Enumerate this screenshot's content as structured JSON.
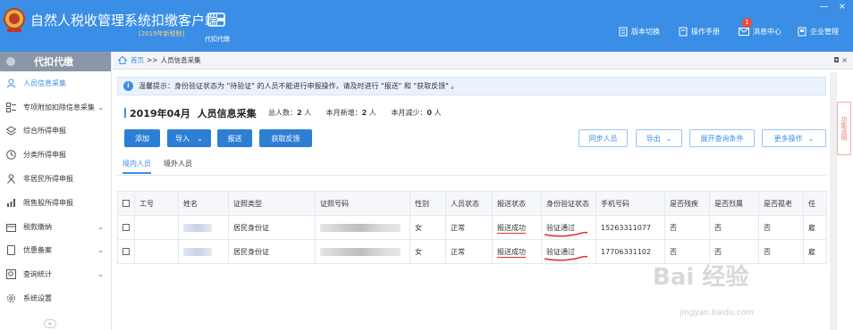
{
  "app": {
    "title": "自然人税收管理系统扣缴客户端",
    "edition": "[2019年新税制]",
    "mode_label": "代扣代缴",
    "colors": {
      "primary": "#3a8ee6",
      "alert": "#e0312b"
    }
  },
  "window_controls": {
    "minimize": "—",
    "close": "×"
  },
  "top_nav": [
    {
      "label": "版本切换",
      "icon": "switch-icon"
    },
    {
      "label": "操作手册",
      "icon": "manual-icon"
    },
    {
      "label": "消息中心",
      "icon": "message-icon",
      "badge": "1"
    },
    {
      "label": "企业管理",
      "icon": "company-icon"
    }
  ],
  "sidebar": {
    "title": "代扣代缴",
    "items": [
      {
        "label": "人员信息采集",
        "icon": "user-icon",
        "active": true
      },
      {
        "label": "专项附加扣除信息采集",
        "icon": "list-icon",
        "has_arrow": true
      },
      {
        "label": "综合所得申报",
        "icon": "layers-icon"
      },
      {
        "label": "分类所得申报",
        "icon": "clock-icon"
      },
      {
        "label": "非居民所得申报",
        "icon": "person-icon"
      },
      {
        "label": "限售股所得申报",
        "icon": "bar-chart-icon"
      },
      {
        "label": "税款缴纳",
        "icon": "box-icon",
        "has_arrow": true
      },
      {
        "label": "优惠备案",
        "icon": "document-icon",
        "has_arrow": true
      },
      {
        "label": "查询统计",
        "icon": "search-icon",
        "has_arrow": true
      },
      {
        "label": "系统设置",
        "icon": "gear-icon"
      }
    ],
    "collapse": "«"
  },
  "breadcrumb": {
    "home": "首页",
    "sep": ">>",
    "current": "人员信息采集",
    "controls": "◘ ×"
  },
  "notice": "温馨提示：身份验证状态为 \"待验证\" 的人员不能进行申报操作，请及时进行 \"报送\" 和 \"获取反馈\" 。",
  "side_tab": "功能说明",
  "section": {
    "period": "2019年04月",
    "title": "人员信息采集",
    "stats": [
      {
        "label": "总人数：",
        "value": "2",
        "unit": "人"
      },
      {
        "label": "本月新增：",
        "value": "2",
        "unit": "人"
      },
      {
        "label": "本月减少：",
        "value": "0",
        "unit": "人"
      }
    ]
  },
  "toolbar": {
    "add": "添加",
    "import": "导入",
    "submit": "报送",
    "feedback": "获取反馈",
    "sync": "同步人员",
    "export": "导出",
    "expand_query": "展开查询条件",
    "more": "更多操作"
  },
  "tabs": [
    "境内人员",
    "境外人员"
  ],
  "table": {
    "columns": [
      "",
      "工号",
      "姓名",
      "证照类型",
      "证照号码",
      "性别",
      "人员状态",
      "报送状态",
      "身份验证状态",
      "手机号码",
      "是否残疾",
      "是否烈属",
      "是否孤老",
      "任"
    ],
    "rows": [
      {
        "id_type": "居民身份证",
        "gender": "女",
        "status": "正常",
        "submit_status": "报送成功",
        "verify_status": "验证通过",
        "phone": "15263311077",
        "disabled": "否",
        "martyr": "否",
        "elderly": "否",
        "extra": "雇"
      },
      {
        "id_type": "居民身份证",
        "gender": "女",
        "status": "正常",
        "submit_status": "报送成功",
        "verify_status": "验证通过",
        "phone": "17706331102",
        "disabled": "否",
        "martyr": "否",
        "elderly": "否",
        "extra": "雇"
      }
    ]
  },
  "watermark": {
    "main": "Bai 经验",
    "sub": "jingyan.baidu.com"
  }
}
